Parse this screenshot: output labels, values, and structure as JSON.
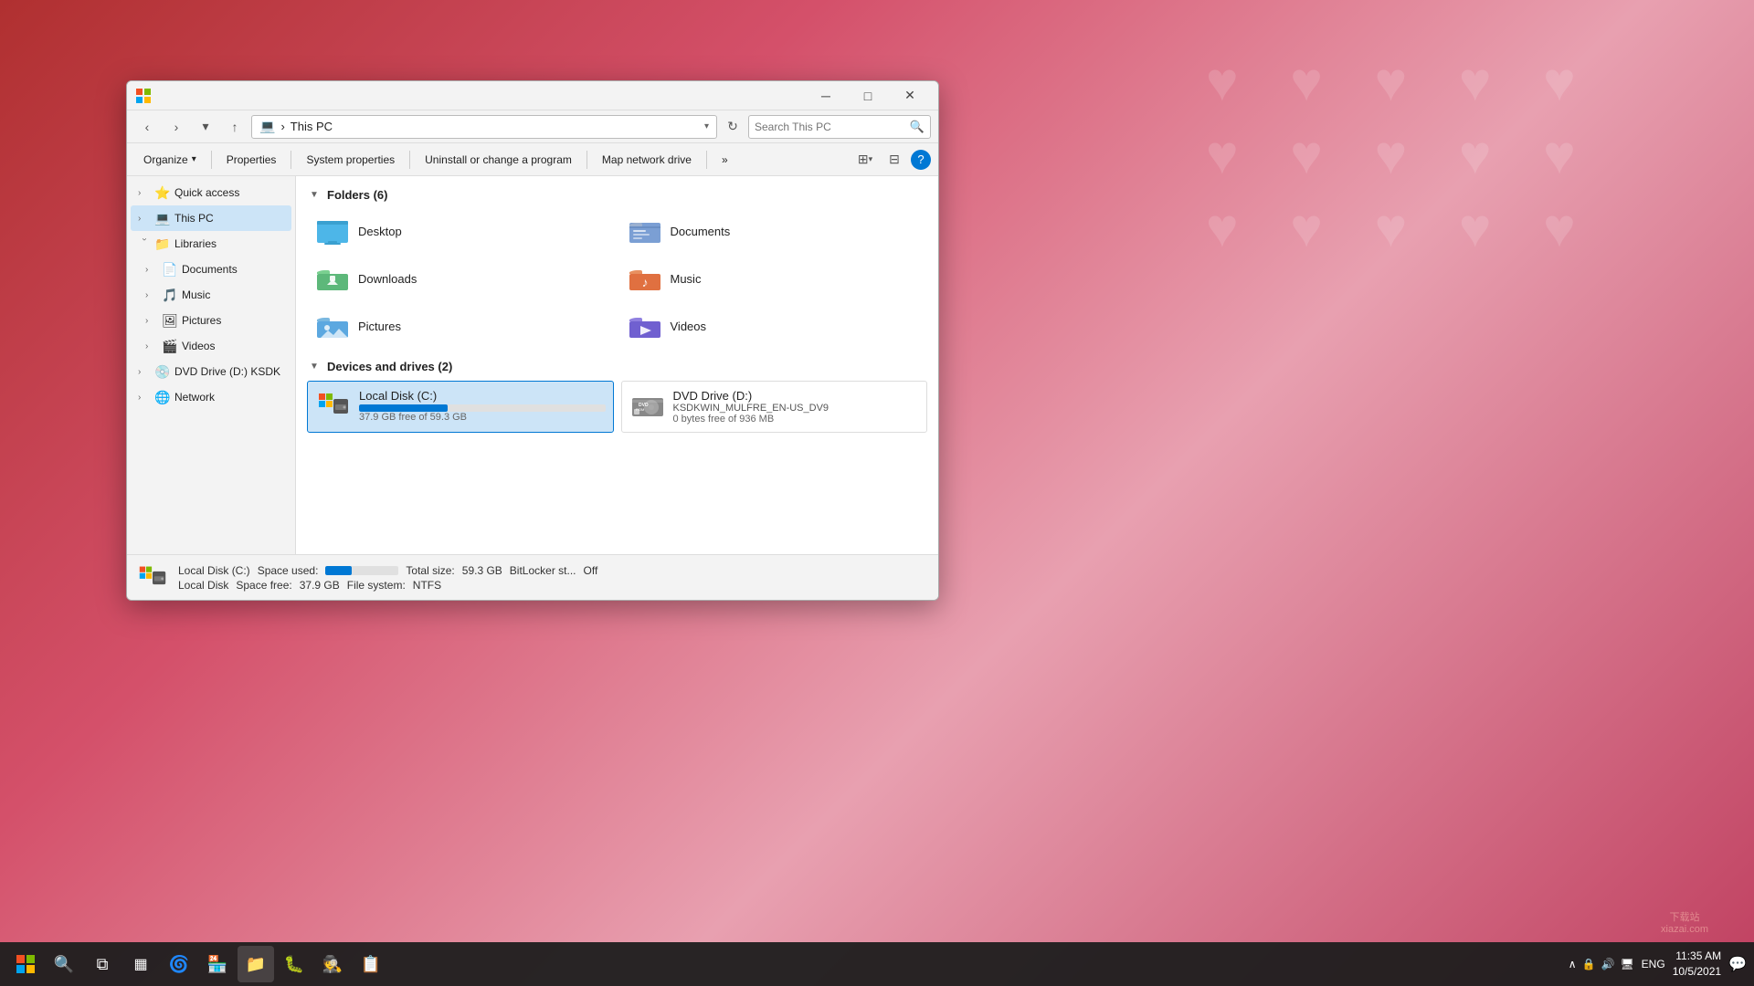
{
  "desktop": {
    "bg_color": "#c0392b"
  },
  "window": {
    "title": "This PC",
    "address": {
      "path": "This PC",
      "icon": "💻",
      "dropdown_label": "▾",
      "search_placeholder": "Search This PC"
    },
    "toolbar": {
      "organize_label": "Organize",
      "properties_label": "Properties",
      "system_properties_label": "System properties",
      "uninstall_label": "Uninstall or change a program",
      "map_drive_label": "Map network drive",
      "more_label": "»"
    },
    "sidebar": {
      "items": [
        {
          "id": "quick-access",
          "label": "Quick access",
          "icon": "⭐",
          "chevron": "›",
          "expanded": false
        },
        {
          "id": "this-pc",
          "label": "This PC",
          "icon": "💻",
          "chevron": "›",
          "active": true
        },
        {
          "id": "libraries",
          "label": "Libraries",
          "icon": "📁",
          "chevron": "›",
          "expanded": true
        },
        {
          "id": "documents",
          "label": "Documents",
          "icon": "📄",
          "chevron": "›",
          "sub": true
        },
        {
          "id": "music",
          "label": "Music",
          "icon": "🎵",
          "chevron": "›",
          "sub": true
        },
        {
          "id": "pictures",
          "label": "Pictures",
          "icon": "🖼",
          "chevron": "›",
          "sub": true
        },
        {
          "id": "videos",
          "label": "Videos",
          "icon": "🎬",
          "chevron": "›",
          "sub": true
        },
        {
          "id": "dvd-drive",
          "label": "DVD Drive (D:) KSDK",
          "icon": "💿",
          "chevron": "›",
          "sub": false
        },
        {
          "id": "network",
          "label": "Network",
          "icon": "🌐",
          "chevron": "›",
          "expanded": false
        }
      ]
    },
    "folders_section": {
      "title": "Folders (6)",
      "items": [
        {
          "id": "desktop",
          "name": "Desktop",
          "icon": "🖥",
          "color": "#4db6e8"
        },
        {
          "id": "documents",
          "name": "Documents",
          "icon": "📄",
          "color": "#7b9fd4"
        },
        {
          "id": "downloads",
          "name": "Downloads",
          "icon": "📥",
          "color": "#5db87a"
        },
        {
          "id": "music",
          "name": "Music",
          "icon": "🎵",
          "color": "#e07040"
        },
        {
          "id": "pictures",
          "name": "Pictures",
          "icon": "🖼",
          "color": "#5ca8e0"
        },
        {
          "id": "videos",
          "name": "Videos",
          "icon": "🎬",
          "color": "#7060d0"
        }
      ]
    },
    "devices_section": {
      "title": "Devices and drives (2)",
      "items": [
        {
          "id": "local-disk",
          "name": "Local Disk (C:)",
          "icon": "💻",
          "selected": true,
          "space_free": "37.9 GB free of 59.3 GB",
          "bar_percent": 36,
          "bar_color": "#0078d4"
        },
        {
          "id": "dvd-drive",
          "name": "DVD Drive (D:)",
          "subtitle": "KSDKWIN_MULFRE_EN-US_DV9",
          "icon": "💿",
          "selected": false,
          "space_free": "0 bytes free of 936 MB",
          "bar_percent": 0
        }
      ]
    },
    "status_bar": {
      "drive_name": "Local Disk (C:)",
      "drive_label": "Local Disk",
      "space_used_label": "Space used:",
      "space_free_label": "Space free:",
      "space_free_value": "37.9 GB",
      "total_size_label": "Total size:",
      "total_size_value": "59.3 GB",
      "file_system_label": "File system:",
      "file_system_value": "NTFS",
      "bitlocker_label": "BitLocker st...",
      "bitlocker_value": "Off",
      "bar_percent": 36
    }
  },
  "taskbar": {
    "time": "11:35 AM",
    "date": "10/5/2021",
    "lang": "ENG",
    "icons": [
      {
        "id": "start",
        "symbol": "⊞",
        "label": "Start"
      },
      {
        "id": "search",
        "symbol": "🔍",
        "label": "Search"
      },
      {
        "id": "task-view",
        "symbol": "⧉",
        "label": "Task View"
      },
      {
        "id": "widgets",
        "symbol": "▦",
        "label": "Widgets"
      },
      {
        "id": "edge",
        "symbol": "🌀",
        "label": "Edge"
      },
      {
        "id": "store",
        "symbol": "🏪",
        "label": "Store"
      },
      {
        "id": "app1",
        "symbol": "🐛",
        "label": "App1"
      },
      {
        "id": "app2",
        "symbol": "🕵",
        "label": "App2"
      },
      {
        "id": "app3",
        "symbol": "📋",
        "label": "App3"
      },
      {
        "id": "file-explorer",
        "symbol": "📁",
        "label": "File Explorer",
        "active": true
      }
    ]
  }
}
